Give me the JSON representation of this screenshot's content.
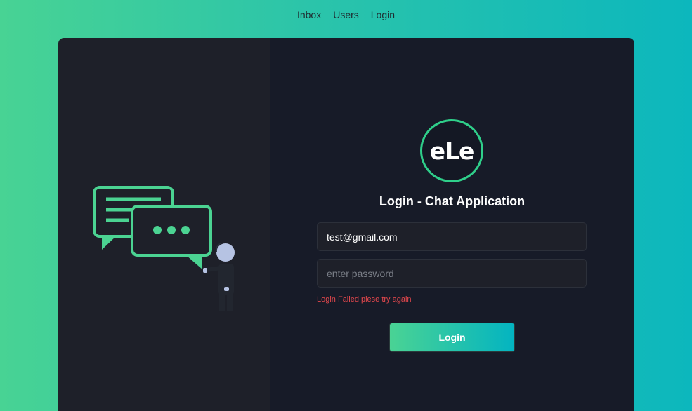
{
  "nav": {
    "items": [
      {
        "label": "Inbox"
      },
      {
        "label": "Users"
      },
      {
        "label": "Login"
      }
    ]
  },
  "logo": {
    "text": "eLe"
  },
  "form": {
    "title": "Login - Chat Application",
    "email_value": "test@gmail.com",
    "password_placeholder": "enter password",
    "error_text": "Login Failed plese try again",
    "submit_label": "Login"
  },
  "colors": {
    "background_gradient_start": "#48d394",
    "background_gradient_end": "#0cb7bd",
    "card_left": "#1e2029",
    "card_right": "#171b28",
    "accent_green": "#2fcf8a",
    "error_red": "#e5484d"
  },
  "illustration": {
    "icon": "chat-bubbles-with-person-icon"
  }
}
